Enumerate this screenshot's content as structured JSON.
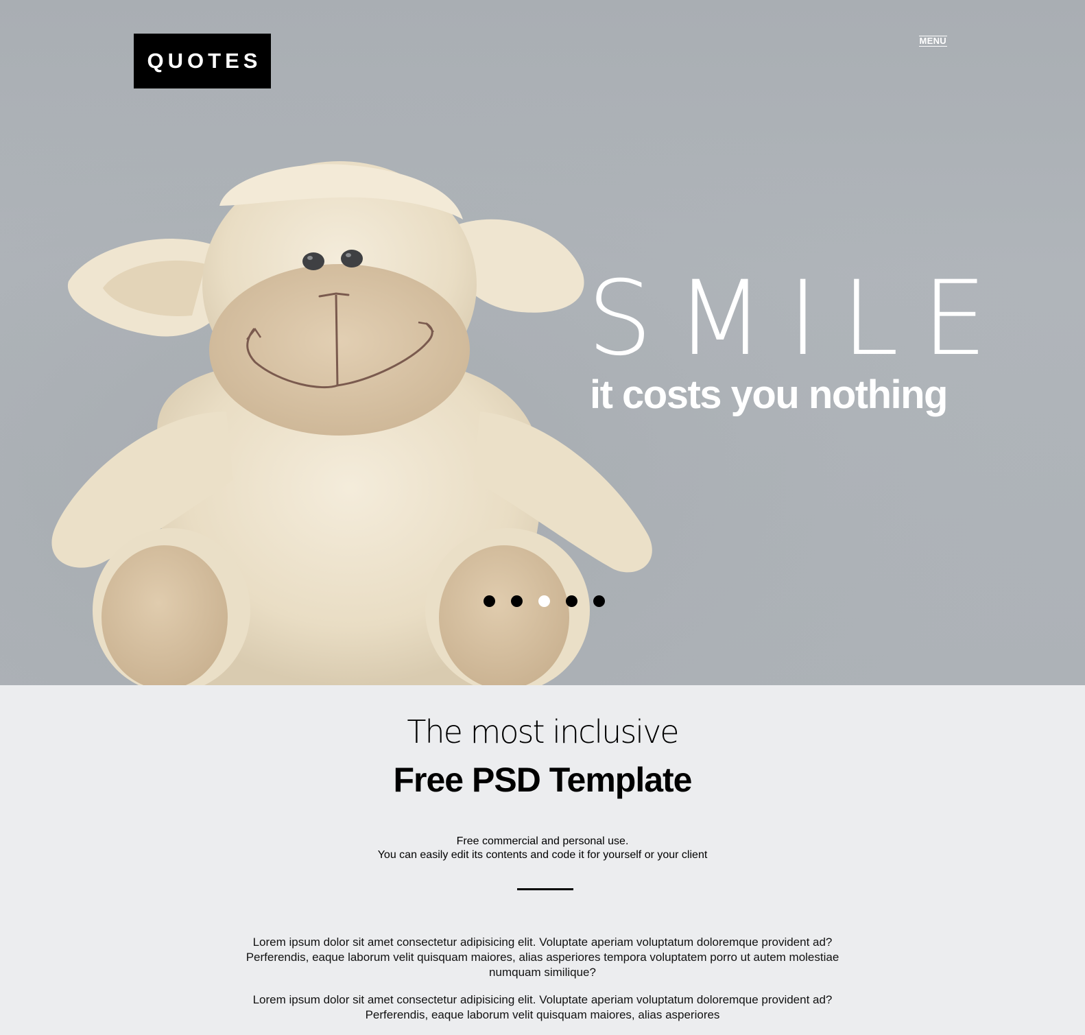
{
  "header": {
    "logo": "QUOTES",
    "menu_label": "MENU"
  },
  "hero": {
    "title": "SMILE",
    "subtitle": "it costs you nothing",
    "slides": 5,
    "active_slide": 3
  },
  "content": {
    "intro_light": "The most inclusive",
    "intro_bold": "Free PSD Template",
    "usage_line1": "Free commercial and personal use.",
    "usage_line2": "You can easily edit its contents and code it for yourself or your client",
    "paragraph1": "Lorem ipsum dolor sit amet consectetur adipisicing elit. Voluptate aperiam voluptatum doloremque provident ad? Perferendis, eaque laborum velit quisquam maiores, alias asperiores tempora voluptatem porro ut autem molestiae numquam similique?",
    "paragraph2": "Lorem ipsum dolor sit amet consectetur adipisicing elit. Voluptate aperiam voluptatum doloremque provident ad? Perferendis, eaque laborum velit quisquam maiores, alias asperiores"
  },
  "colors": {
    "hero_bg": "#adb2b7",
    "content_bg": "#ecedef",
    "plush": "#efe6d2",
    "text": "#000000",
    "accent_white": "#ffffff"
  }
}
